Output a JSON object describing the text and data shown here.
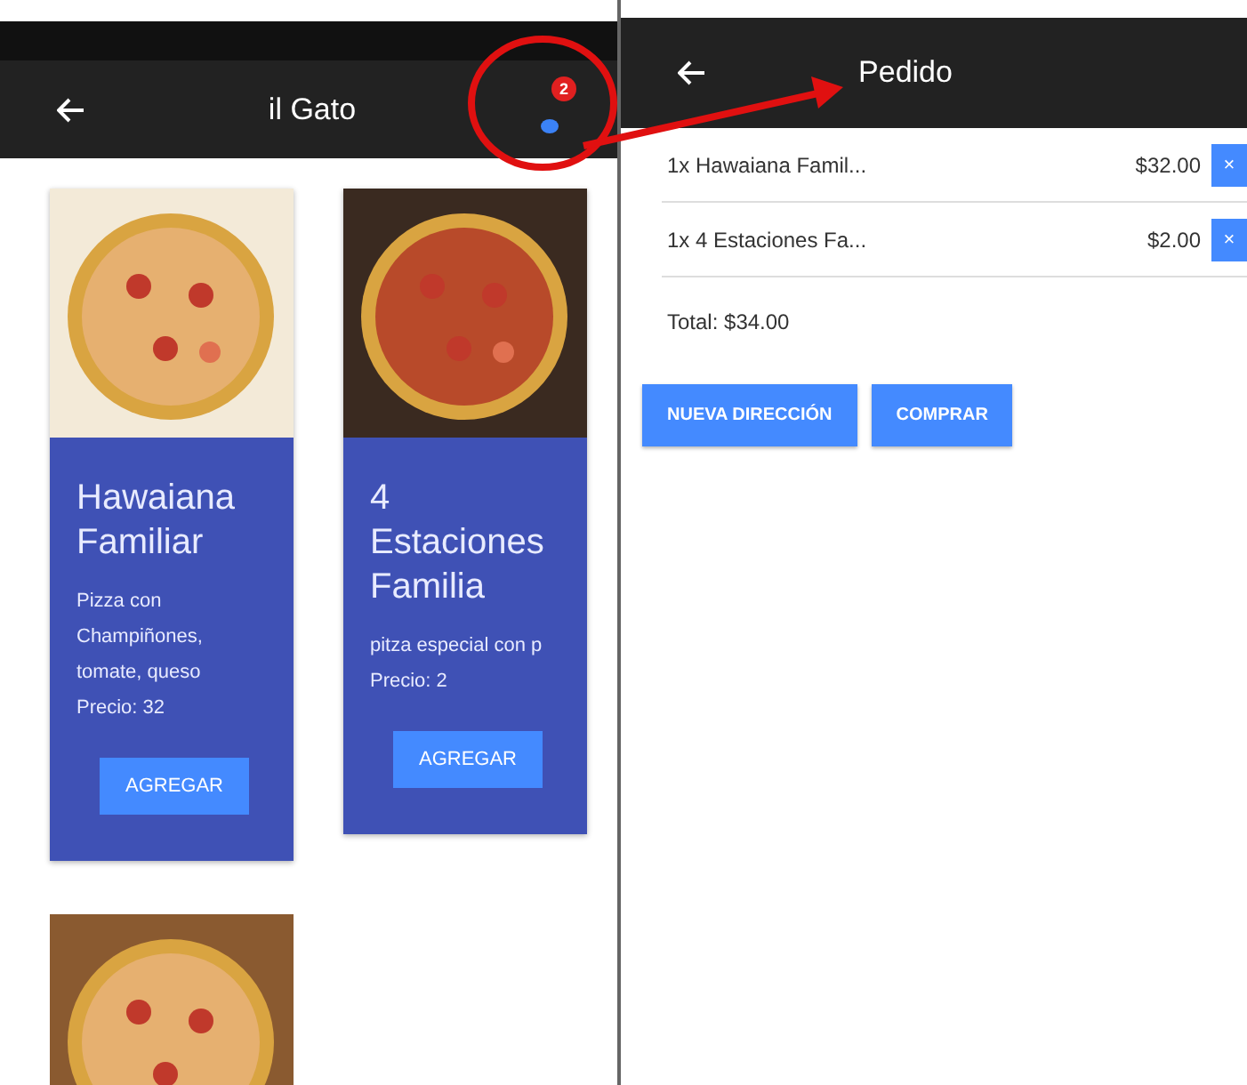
{
  "catalog": {
    "title": "il Gato",
    "cart_badge": "2",
    "products": [
      {
        "name": "Hawaiana Familiar",
        "description": "Pizza con Champiñones, tomate, queso",
        "price": "Precio: 32",
        "button": "AGREGAR"
      },
      {
        "name": "4 Estaciones Familia",
        "description": "pitza especial con p",
        "price": "Precio: 2",
        "button": "AGREGAR"
      }
    ]
  },
  "order": {
    "title": "Pedido",
    "items": [
      {
        "text": "1x Hawaiana Famil...",
        "price": "$32.00",
        "remove": "×"
      },
      {
        "text": "1x 4 Estaciones Fa...",
        "price": "$2.00",
        "remove": "×"
      }
    ],
    "total": "Total: $34.00",
    "buttons": [
      "NUEVA DIRECCIÓN",
      "COMPRAR"
    ]
  }
}
